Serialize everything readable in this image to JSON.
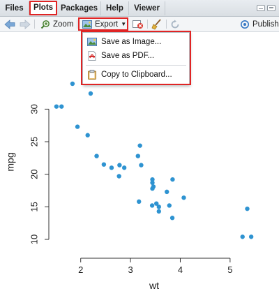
{
  "tabs": [
    {
      "label": "Files",
      "active": false
    },
    {
      "label": "Plots",
      "active": true
    },
    {
      "label": "Packages",
      "active": false
    },
    {
      "label": "Help",
      "active": false
    },
    {
      "label": "Viewer",
      "active": false
    }
  ],
  "toolbar": {
    "zoom_label": "Zoom",
    "export_label": "Export",
    "publish_label": "Publish"
  },
  "export_menu": {
    "items": [
      "Save as Image...",
      "Save as PDF...",
      "Copy to Clipboard..."
    ]
  },
  "colors": {
    "highlight": "#e02424",
    "point": "#2e93d1"
  },
  "chart_data": {
    "type": "scatter",
    "xlabel": "wt",
    "ylabel": "mpg",
    "xlim": [
      1.5,
      5.45
    ],
    "ylim": [
      10.0,
      33.9
    ],
    "xticks": [
      2,
      3,
      4,
      5
    ],
    "yticks": [
      10,
      15,
      20,
      25,
      30
    ],
    "points": [
      [
        2.62,
        21.0
      ],
      [
        2.875,
        21.0
      ],
      [
        2.32,
        22.8
      ],
      [
        3.215,
        21.4
      ],
      [
        3.44,
        18.7
      ],
      [
        3.46,
        18.1
      ],
      [
        3.57,
        14.3
      ],
      [
        3.19,
        24.4
      ],
      [
        3.15,
        22.8
      ],
      [
        3.44,
        19.2
      ],
      [
        3.44,
        17.8
      ],
      [
        4.07,
        16.4
      ],
      [
        3.73,
        17.3
      ],
      [
        3.78,
        15.2
      ],
      [
        5.25,
        10.4
      ],
      [
        5.424,
        10.4
      ],
      [
        5.345,
        14.7
      ],
      [
        2.2,
        32.4
      ],
      [
        1.615,
        30.4
      ],
      [
        1.835,
        33.9
      ],
      [
        2.465,
        21.5
      ],
      [
        3.52,
        15.5
      ],
      [
        3.435,
        15.2
      ],
      [
        3.84,
        13.3
      ],
      [
        3.845,
        19.2
      ],
      [
        1.935,
        27.3
      ],
      [
        2.14,
        26.0
      ],
      [
        1.513,
        30.4
      ],
      [
        3.17,
        15.8
      ],
      [
        2.77,
        19.7
      ],
      [
        3.57,
        15.0
      ],
      [
        2.78,
        21.4
      ]
    ]
  }
}
